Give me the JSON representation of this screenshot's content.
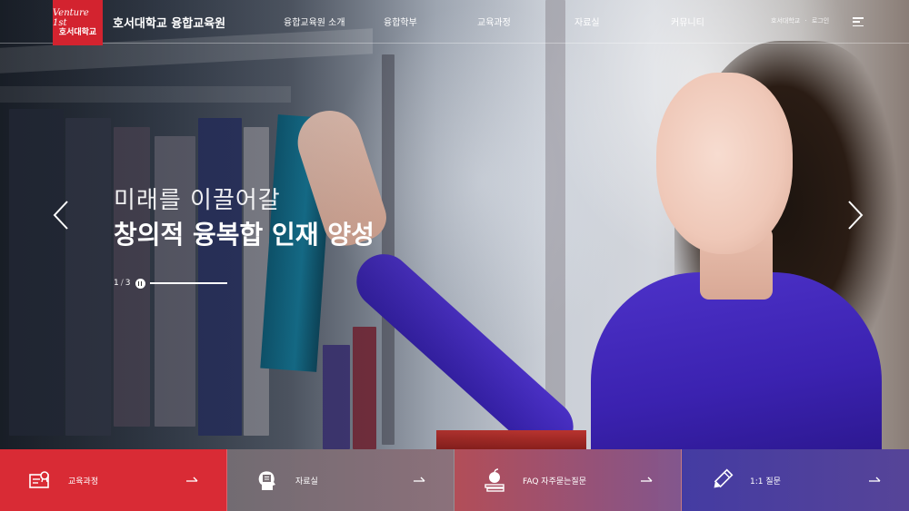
{
  "header": {
    "logo_top": "Venture 1st",
    "logo_bottom": "호서대학교",
    "site_title": "호서대학교 융합교육원",
    "nav": [
      {
        "label": "융합교육원 소개"
      },
      {
        "label": "융합학부"
      },
      {
        "label": "교육과정"
      },
      {
        "label": "자료실"
      },
      {
        "label": "커뮤니티"
      }
    ],
    "util_university": "호서대학교",
    "util_separator": "·",
    "util_login": "로그인",
    "menu_icon": "hamburger-menu-icon"
  },
  "hero": {
    "line1": "미래를 이끌어갈",
    "line2": "창의적 융복합 인재 양성",
    "prev_icon": "chevron-left-icon",
    "next_icon": "chevron-right-icon",
    "pager": {
      "current": "1",
      "separator": "/",
      "total": "3",
      "progress_fraction": 1.0
    }
  },
  "quick_links": [
    {
      "label": "교육과정",
      "icon": "certificate-icon",
      "color": "#d92b35"
    },
    {
      "label": "자료실",
      "icon": "head-document-icon"
    },
    {
      "label": "FAQ 자주묻는질문",
      "icon": "apple-book-icon"
    },
    {
      "label": "1:1 질문",
      "icon": "pencil-icon"
    }
  ],
  "colors": {
    "brand_red": "#d3232f",
    "sweater_purple": "#3b22b0"
  }
}
